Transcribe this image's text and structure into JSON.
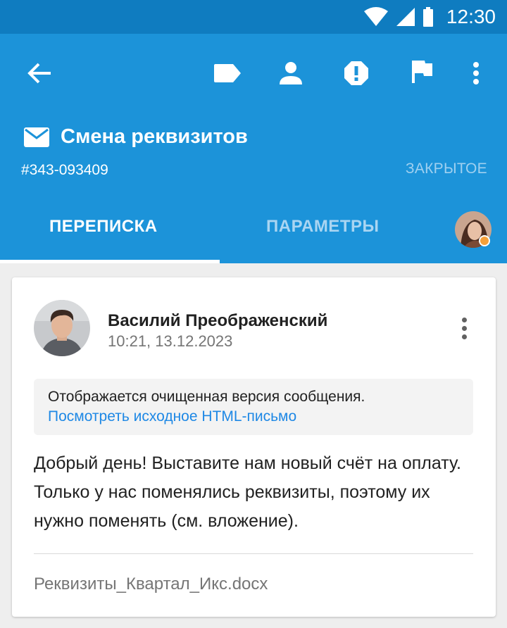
{
  "status_bar": {
    "time": "12:30",
    "icons": [
      "wifi-icon",
      "signal-icon",
      "battery-icon"
    ]
  },
  "appbar": {
    "actions": [
      "back-arrow-icon",
      "tag-icon",
      "person-icon",
      "alert-icon",
      "flag-icon",
      "more-vert-icon"
    ],
    "title": "Смена реквизитов",
    "title_icon": "envelope-icon",
    "ticket_id": "#343-093409",
    "status": "ЗАКРЫТОЕ",
    "tabs": [
      {
        "label": "ПЕРЕПИСКА",
        "active": true
      },
      {
        "label": "ПАРАМЕТРЫ",
        "active": false
      }
    ],
    "assignee_status_color": "#f5a03a"
  },
  "message": {
    "sender": "Василий Преображенский",
    "datetime": "10:21, 13.12.2023",
    "notice_text": "Отображается очищенная версия сообщения.",
    "notice_link": "Посмотреть исходное HTML-письмо",
    "body": "Добрый день! Выставите нам новый счёт на оплату. Только у нас поменялись реквизиты, поэтому их нужно поменять (см. вложение).",
    "attachment": "Реквизиты_Квартал_Икс.docx"
  },
  "colors": {
    "primary": "#1c93d9",
    "status_bar": "#0f7cc0",
    "link": "#1e88e5"
  }
}
